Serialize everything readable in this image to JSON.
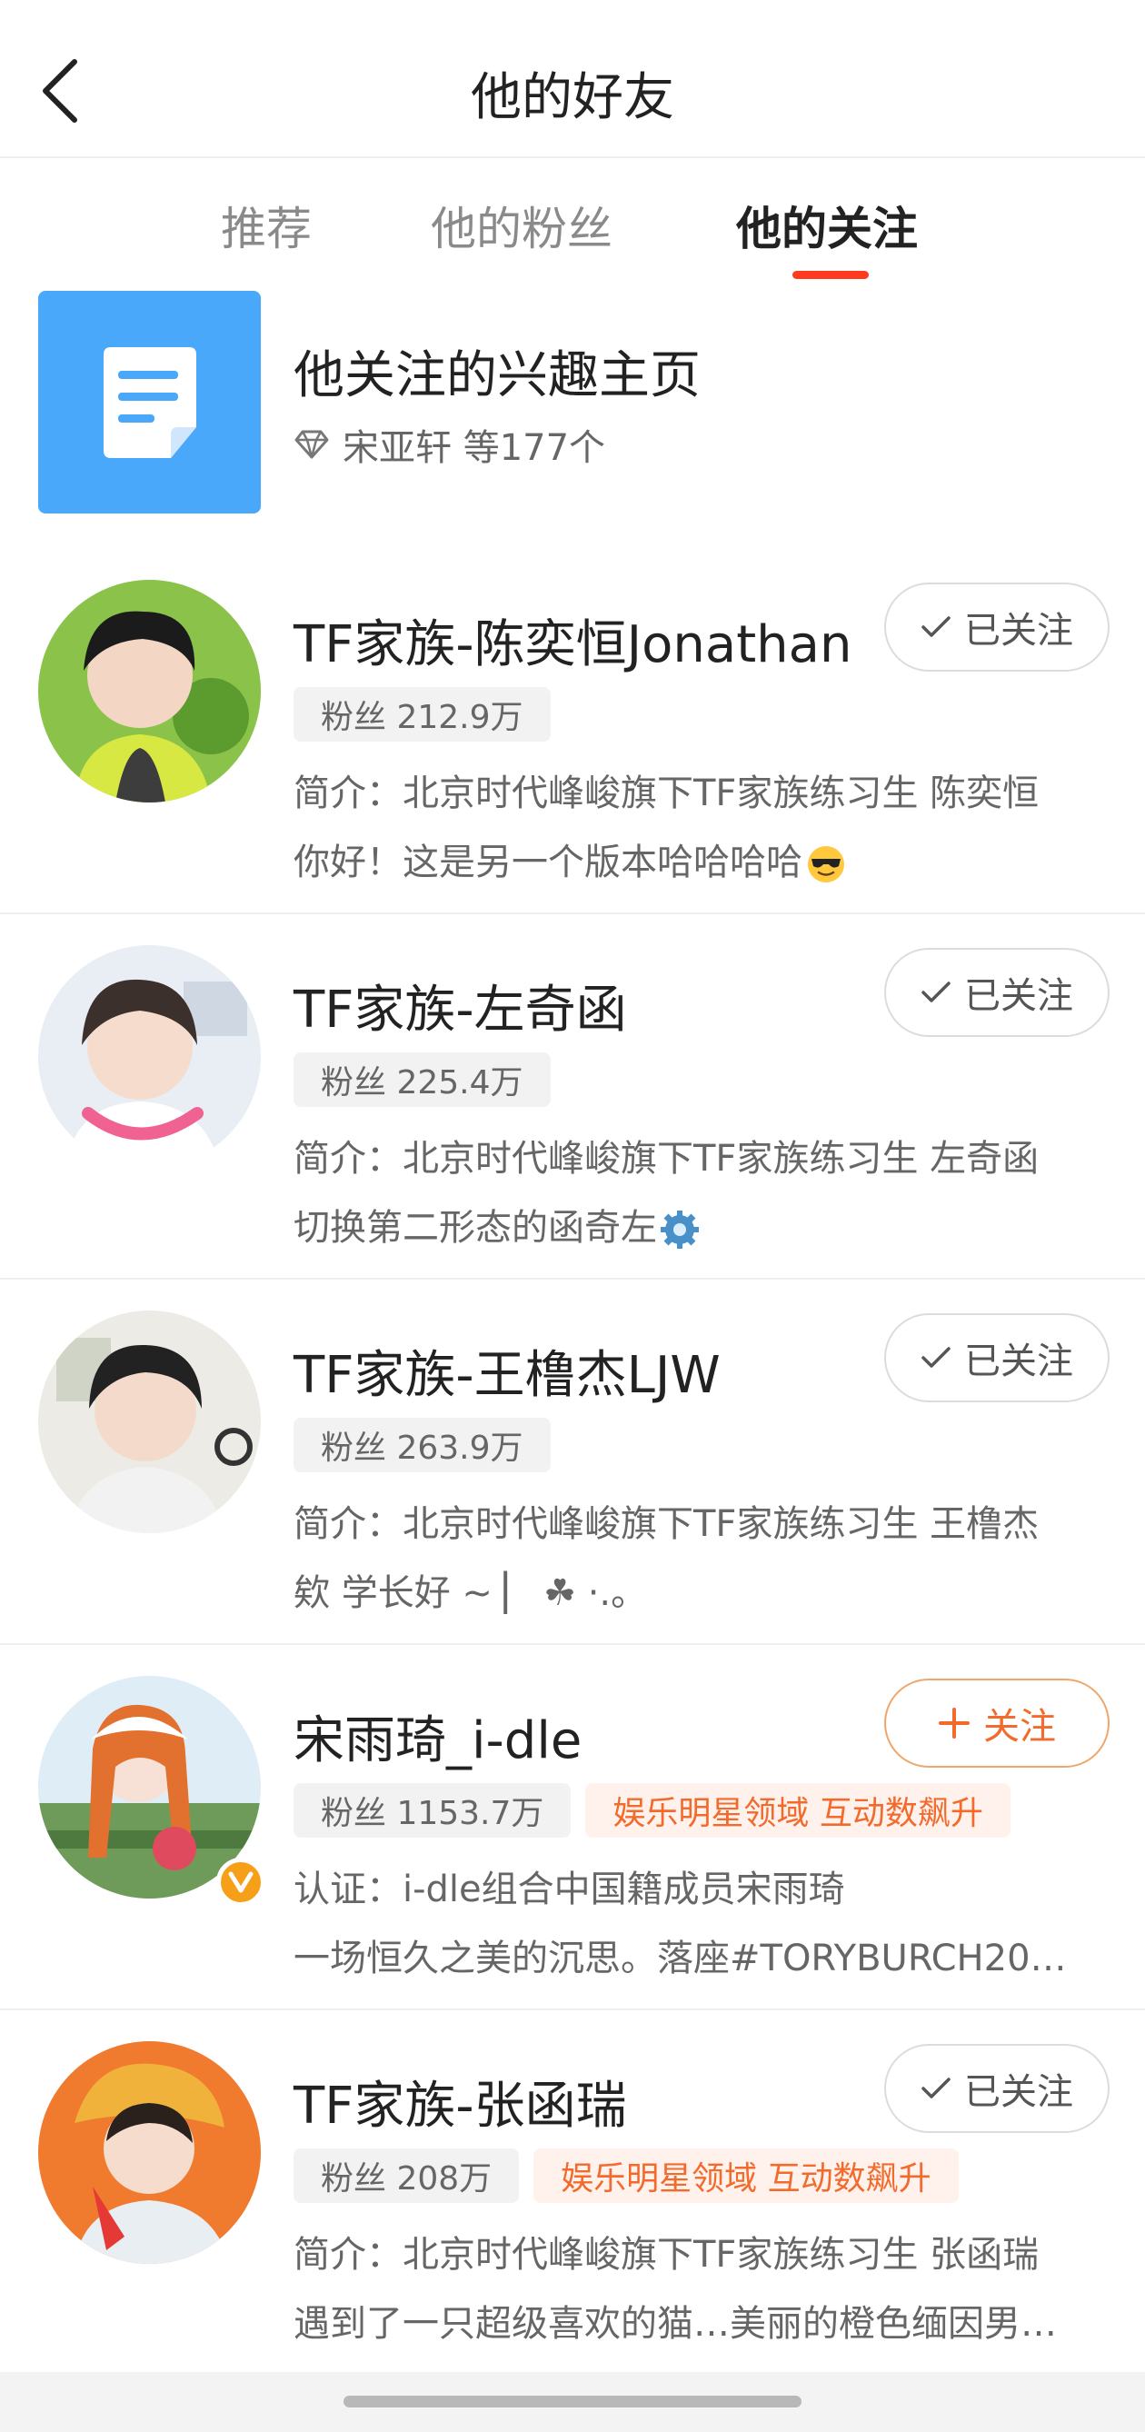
{
  "header": {
    "title": "他的好友",
    "back_icon": "chevron-left-icon"
  },
  "tabs": [
    {
      "label": "推荐",
      "active": false
    },
    {
      "label": "他的粉丝",
      "active": false
    },
    {
      "label": "他的关注",
      "active": true
    }
  ],
  "interest_card": {
    "title": "他关注的兴趣主页",
    "subtitle": "宋亚轩 等177个",
    "icon": "document-icon",
    "icon_color": "#4aa8fb"
  },
  "users": [
    {
      "name": "TF家族-陈奕恒Jonathan",
      "fans": "粉丝 212.9万",
      "tag": "",
      "desc1": "简介：北京时代峰峻旗下TF家族练习生 陈奕恒",
      "desc2": "你好！这是另一个版本哈哈哈哈",
      "follow_label": "已关注",
      "following": true,
      "verified": false
    },
    {
      "name": "TF家族-左奇函",
      "fans": "粉丝 225.4万",
      "tag": "",
      "desc1": "简介：北京时代峰峻旗下TF家族练习生 左奇函",
      "desc2": "切换第二形态的函奇左",
      "follow_label": "已关注",
      "following": true,
      "verified": false
    },
    {
      "name": "TF家族-王橹杰LJW",
      "fans": "粉丝 263.9万",
      "tag": "",
      "desc1": "简介：北京时代峰峻旗下TF家族练习生 王橹杰",
      "desc2": "欸 学长好 ~ ▏          ☘ ·.。",
      "follow_label": "已关注",
      "following": true,
      "verified": false
    },
    {
      "name": "宋雨琦_i-dle",
      "fans": "粉丝 1153.7万",
      "tag": "娱乐明星领域 互动数飙升",
      "desc1": "认证：i-dle组合中国籍成员宋雨琦",
      "desc2": "一场恒久之美的沉思。落座#TORYBURCH20…",
      "follow_label": "关注",
      "following": false,
      "verified": true
    },
    {
      "name": "TF家族-张函瑞",
      "fans": "粉丝 208万",
      "tag": "娱乐明星领域 互动数飙升",
      "desc1": "简介：北京时代峰峻旗下TF家族练习生 张函瑞",
      "desc2": "遇到了一只超级喜欢的猫…美丽的橙色缅因男…",
      "follow_label": "已关注",
      "following": true,
      "verified": false
    }
  ],
  "colors": {
    "accent": "#ff3b1f",
    "orange": "#f26b2c",
    "verified": "#f6a01a"
  }
}
